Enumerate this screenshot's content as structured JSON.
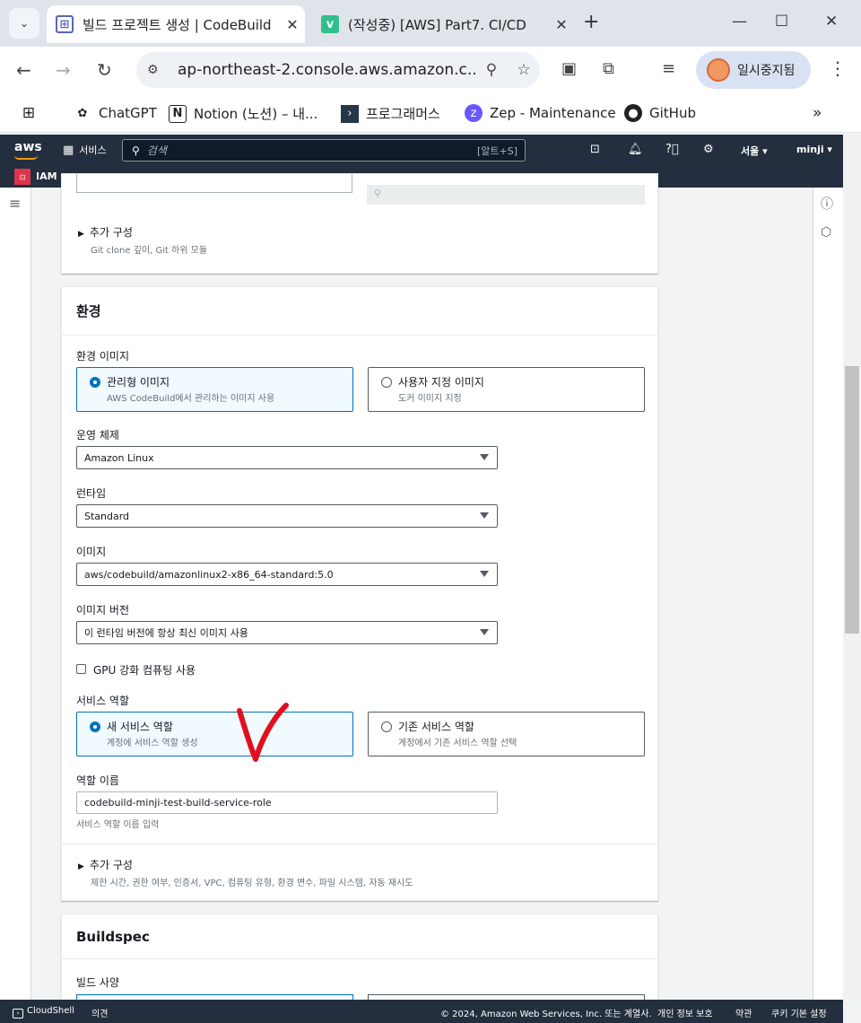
{
  "browser": {
    "tabs": [
      {
        "title": "빌드 프로젝트 생성 | CodeBuild",
        "active": true
      },
      {
        "title": "(작성중) [AWS] Part7. CI/CD",
        "active": false
      }
    ],
    "url": "ap-northeast-2.console.aws.amazon.c...",
    "profile_label": "일시중지됨",
    "bookmarks": [
      "ChatGPT",
      "Notion (노션) – 내...",
      "프로그래머스",
      "Zep - Maintenance",
      "GitHub"
    ]
  },
  "aws_nav": {
    "logo": "aws",
    "services_label": "서비스",
    "search_placeholder": "검색",
    "search_shortcut": "[알트+S]",
    "region": "서울 ▾",
    "user": "minji ▾",
    "favorite": "IAM"
  },
  "source_panel": {
    "expander_title": "추가 구성",
    "expander_desc": "Git clone 깊이, Git 하위 모듈"
  },
  "environment": {
    "header": "환경",
    "image_label": "환경 이미지",
    "image_options": [
      {
        "title": "관리형 이미지",
        "desc": "AWS CodeBuild에서 관리하는 이미지 사용",
        "selected": true
      },
      {
        "title": "사용자 지정 이미지",
        "desc": "도커 이미지 지정",
        "selected": false
      }
    ],
    "os_label": "운영 체제",
    "os_value": "Amazon Linux",
    "runtime_label": "런타임",
    "runtime_value": "Standard",
    "image_select_label": "이미지",
    "image_value": "aws/codebuild/amazonlinux2-x86_64-standard:5.0",
    "version_label": "이미지 버전",
    "version_value": "이 런타임 버전에 항상 최신 이미지 사용",
    "gpu_label": "GPU 강화 컴퓨팅 사용",
    "gpu_checked": false,
    "service_role_label": "서비스 역할",
    "service_role_options": [
      {
        "title": "새 서비스 역할",
        "desc": "계정에 서비스 역할 생성",
        "selected": true
      },
      {
        "title": "기존 서비스 역할",
        "desc": "계정에서 기존 서비스 역할 선택",
        "selected": false
      }
    ],
    "role_name_label": "역할 이름",
    "role_name_value": "codebuild-minji-test-build-service-role",
    "role_name_desc": "서비스 역할 이름 입력",
    "expander_title": "추가 구성",
    "expander_desc": "제한 시간, 권한 여부, 인증서, VPC, 컴퓨팅 유형, 환경 변수, 파일 시스템, 자동 재시도"
  },
  "buildspec": {
    "header": "Buildspec",
    "spec_label": "빌드 사양"
  },
  "footer": {
    "cloudshell": "CloudShell",
    "feedback": "의견",
    "copyright": "© 2024, Amazon Web Services, Inc. 또는 계열사.",
    "privacy": "개인 정보 보호",
    "terms": "약관",
    "cookies": "쿠키 기본 설정"
  },
  "annotation_color": "#e0101e",
  "accent_color": "#0073bb"
}
